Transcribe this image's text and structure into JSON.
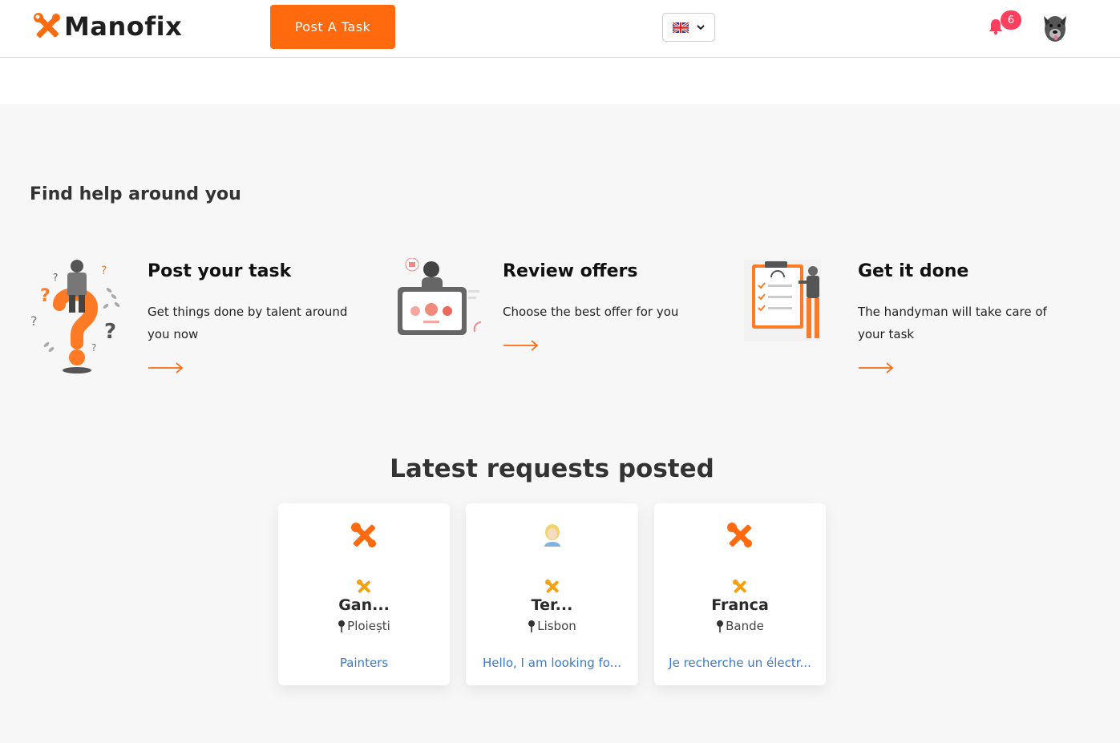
{
  "header": {
    "logo_text": "Manofix",
    "post_task_label": "Post A Task",
    "notification_count": "6",
    "language": "en-GB"
  },
  "colors": {
    "accent": "#ff6a0f",
    "badge": "#ff3f5e",
    "link": "#3d79c9"
  },
  "help": {
    "title": "Find help around you",
    "steps": [
      {
        "title": "Post your task",
        "text": "Get things done by talent around you now",
        "icon": "question-person-illustration"
      },
      {
        "title": "Review offers",
        "text": "Choose the best offer for you",
        "icon": "tablet-rating-illustration"
      },
      {
        "title": "Get it done",
        "text": "The handyman will take care of your task",
        "icon": "checklist-person-illustration"
      }
    ]
  },
  "latest": {
    "title": "Latest requests posted",
    "cards": [
      {
        "name": "Gan...",
        "location": "Ploiești",
        "description": "Painters",
        "avatar": "tools-icon"
      },
      {
        "name": "Ter...",
        "location": "Lisbon",
        "description": "Hello, I am looking fo...",
        "avatar": "user-avatar-icon"
      },
      {
        "name": "Franca",
        "location": "Bande",
        "description": "Je recherche un électr...",
        "avatar": "tools-icon"
      }
    ]
  }
}
